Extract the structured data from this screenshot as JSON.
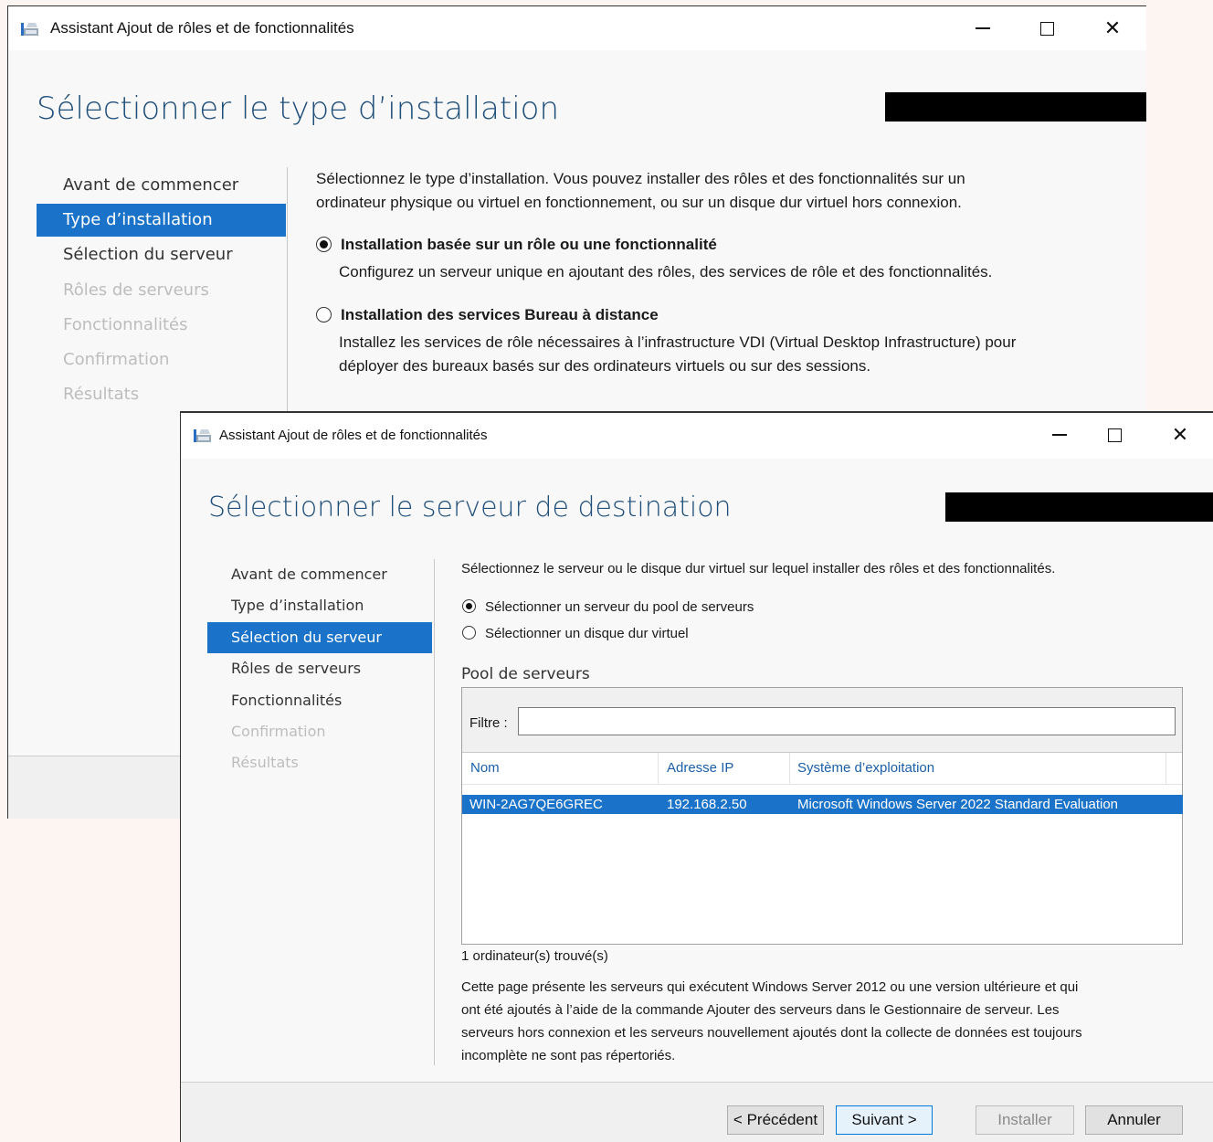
{
  "window1": {
    "title": "Assistant Ajout de rôles et de fonctionnalités",
    "heading": "Sélectionner le type d’installation",
    "nav": [
      {
        "label": "Avant de commencer",
        "state": "normal"
      },
      {
        "label": "Type d’installation",
        "state": "selected"
      },
      {
        "label": "Sélection du serveur",
        "state": "normal"
      },
      {
        "label": "Rôles de serveurs",
        "state": "disabled"
      },
      {
        "label": "Fonctionnalités",
        "state": "disabled"
      },
      {
        "label": "Confirmation",
        "state": "disabled"
      },
      {
        "label": "Résultats",
        "state": "disabled"
      }
    ],
    "intro_line1": "Sélectionnez le type d’installation. Vous pouvez installer des rôles et des fonctionnalités sur un",
    "intro_line2": "ordinateur physique ou virtuel en fonctionnement, ou sur un disque dur virtuel hors connexion.",
    "option1_title": "Installation basée sur un rôle ou une fonctionnalité",
    "option1_desc": "Configurez un serveur unique en ajoutant des rôles, des services de rôle et des fonctionnalités.",
    "option2_title": "Installation des services Bureau à distance",
    "option2_desc_line1": "Installez les services de rôle nécessaires à l’infrastructure VDI (Virtual Desktop Infrastructure) pour",
    "option2_desc_line2": "déployer des bureaux basés sur des ordinateurs virtuels ou sur des sessions."
  },
  "window2": {
    "title": "Assistant Ajout de rôles et de fonctionnalités",
    "heading": "Sélectionner le serveur de destination",
    "nav": [
      {
        "label": "Avant de commencer",
        "state": "normal"
      },
      {
        "label": "Type d’installation",
        "state": "normal"
      },
      {
        "label": "Sélection du serveur",
        "state": "selected"
      },
      {
        "label": "Rôles de serveurs",
        "state": "normal"
      },
      {
        "label": "Fonctionnalités",
        "state": "normal"
      },
      {
        "label": "Confirmation",
        "state": "disabled"
      },
      {
        "label": "Résultats",
        "state": "disabled"
      }
    ],
    "intro": "Sélectionnez le serveur ou le disque dur virtuel sur lequel installer des rôles et des fonctionnalités.",
    "radio_pool": "Sélectionner un serveur du pool de serveurs",
    "radio_vhd": "Sélectionner un disque dur virtuel",
    "pool_label": "Pool de serveurs",
    "filter_label": "Filtre :",
    "filter_value": "",
    "columns": [
      "Nom",
      "Adresse IP",
      "Système d’exploitation"
    ],
    "rows": [
      {
        "name": "WIN-2AG7QE6GREC",
        "ip": "192.168.2.50",
        "os": "Microsoft Windows Server 2022 Standard Evaluation"
      }
    ],
    "count": "1 ordinateur(s) trouvé(s)",
    "note_lines": [
      "Cette page présente les serveurs qui exécutent Windows Server 2012 ou une version ultérieure et qui",
      "ont été ajoutés à l’aide de la commande Ajouter des serveurs dans le Gestionnaire de serveur. Les",
      "serveurs hors connexion et les serveurs nouvellement ajoutés dont la collecte de données est toujours",
      "incomplète ne sont pas répertoriés."
    ],
    "buttons": {
      "previous": "< Précédent",
      "next": "Suivant >",
      "install": "Installer",
      "cancel": "Annuler"
    }
  },
  "colors": {
    "accent": "#1a73c8",
    "heading": "#1f4e79",
    "disabled": "#bdbdbd"
  }
}
